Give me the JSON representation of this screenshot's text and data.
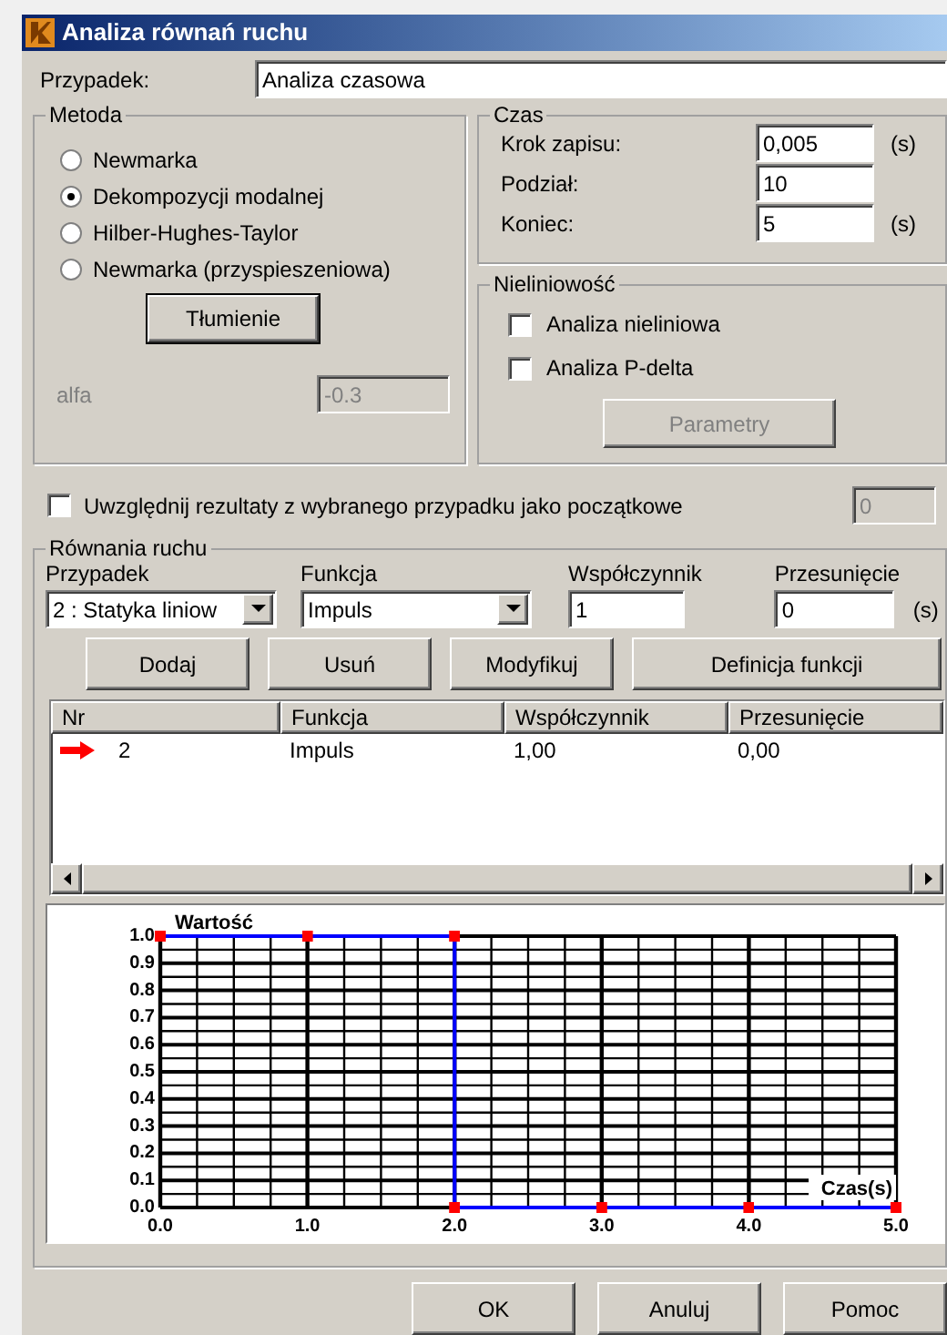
{
  "window": {
    "title": "Analiza równań ruchu"
  },
  "case": {
    "label": "Przypadek:",
    "value": "Analiza czasowa"
  },
  "method": {
    "title": "Metoda",
    "options": [
      {
        "label": "Newmarka",
        "selected": false
      },
      {
        "label": "Dekompozycji modalnej",
        "selected": true
      },
      {
        "label": "Hilber-Hughes-Taylor",
        "selected": false
      },
      {
        "label": "Newmarka (przyspieszeniowa)",
        "selected": false
      }
    ],
    "damping_button": "Tłumienie",
    "alfa": {
      "label": "alfa",
      "value": "-0.3",
      "disabled": true
    }
  },
  "time": {
    "title": "Czas",
    "fields": [
      {
        "label": "Krok zapisu:",
        "value": "0,005",
        "unit": "(s)"
      },
      {
        "label": "Podział:",
        "value": "10"
      },
      {
        "label": "Koniec:",
        "value": "5",
        "unit": "(s)"
      }
    ]
  },
  "nonlinearity": {
    "title": "Nieliniowość",
    "options": [
      {
        "label": "Analiza nieliniowa",
        "checked": false
      },
      {
        "label": "Analiza P-delta",
        "checked": false
      }
    ],
    "params_button": {
      "label": "Parametry",
      "disabled": true
    }
  },
  "initial": {
    "label": "Uwzględnij rezultaty z wybranego przypadku jako początkowe",
    "checked": false,
    "value": "0",
    "disabled": true
  },
  "equations": {
    "title": "Równania ruchu",
    "inputs": [
      {
        "kind": "dropdown",
        "label": "Przypadek",
        "value": "2 : Statyka liniow"
      },
      {
        "kind": "dropdown",
        "label": "Funkcja",
        "value": "Impuls"
      },
      {
        "kind": "text",
        "label": "Współczynnik",
        "value": "1"
      },
      {
        "kind": "text",
        "label": "Przesunięcie",
        "value": "0",
        "unit": "(s)"
      }
    ],
    "buttons": [
      "Dodaj",
      "Usuń",
      "Modyfikuj",
      "Definicja funkcji"
    ],
    "table": {
      "columns": [
        "Nr",
        "Funkcja",
        "Współczynnik",
        "Przesunięcie"
      ],
      "rows": [
        {
          "current": true,
          "cells": [
            "2",
            "Impuls",
            "1,00",
            "0,00"
          ]
        }
      ]
    },
    "chart_data": {
      "type": "line",
      "xlabel": "Czas(s)",
      "ylabel": "Wartość",
      "x": [
        0,
        1,
        2,
        2,
        3,
        4,
        5
      ],
      "series": [
        {
          "color": "#0000ff",
          "values": [
            1,
            1,
            1,
            0,
            0,
            0,
            0
          ]
        }
      ],
      "grid": true,
      "xlim": [
        0,
        5
      ],
      "ylim": [
        0,
        1
      ],
      "xticks": [
        {
          "value": 0,
          "label": "0.0"
        },
        {
          "value": 1,
          "label": "1.0"
        },
        {
          "value": 2,
          "label": "2.0"
        },
        {
          "value": 3,
          "label": "3.0"
        },
        {
          "value": 4,
          "label": "4.0"
        },
        {
          "value": 5,
          "label": "5.0"
        }
      ],
      "yticks": [
        {
          "value": 0,
          "label": "0.0"
        },
        {
          "value": 0.1,
          "label": "0.1"
        },
        {
          "value": 0.2,
          "label": "0.2"
        },
        {
          "value": 0.3,
          "label": "0.3"
        },
        {
          "value": 0.4,
          "label": "0.4"
        },
        {
          "value": 0.5,
          "label": "0.5"
        },
        {
          "value": 0.6,
          "label": "0.6"
        },
        {
          "value": 0.7,
          "label": "0.7"
        },
        {
          "value": 0.8,
          "label": "0.8"
        },
        {
          "value": 0.9,
          "label": "0.9"
        },
        {
          "value": 1,
          "label": "1.0"
        }
      ]
    }
  },
  "footer_buttons": [
    "OK",
    "Anuluj",
    "Pomoc"
  ]
}
